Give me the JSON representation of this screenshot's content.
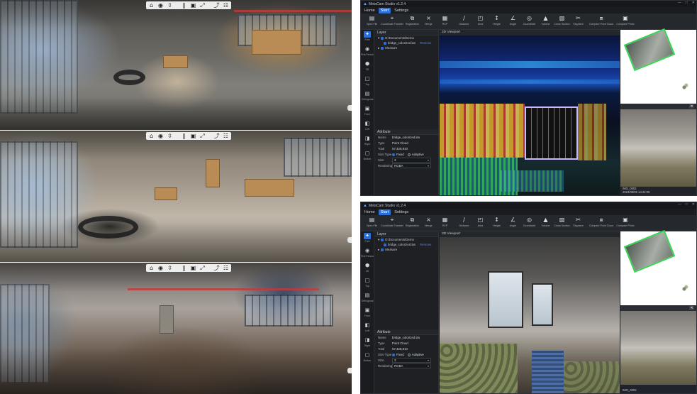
{
  "viewer": {
    "toolbar_icons": [
      "home-icon",
      "pin-icon",
      "arrows-icon",
      "pause-icon",
      "layers-icon",
      "expand-icon",
      "share-icon",
      "gallery-icon"
    ],
    "toolbar_glyphs": [
      "⌂",
      "◉",
      "⇳",
      "‖",
      "▣",
      "⤢",
      "⤴",
      "☷"
    ]
  },
  "app": {
    "title": "MetaCam Studio v1.2.4",
    "menu": [
      "Home",
      "Start",
      "Settings"
    ],
    "active_menu": "Start",
    "ribbon": [
      {
        "icon": "folder-icon",
        "glyph": "▤",
        "label": "Open File"
      },
      {
        "icon": "transform-icon",
        "glyph": "⌖",
        "label": "Coordinate Transfer"
      },
      {
        "icon": "registration-icon",
        "glyph": "⧉",
        "label": "Registration"
      },
      {
        "icon": "merge-icon",
        "glyph": "⨯",
        "label": "Merge"
      },
      {
        "icon": "rcp-icon",
        "glyph": "▦",
        "label": "RCP"
      },
      {
        "icon": "distance-icon",
        "glyph": "∕",
        "label": "Distance"
      },
      {
        "icon": "area-icon",
        "glyph": "◰",
        "label": "Area"
      },
      {
        "icon": "height-icon",
        "glyph": "↕",
        "label": "Height"
      },
      {
        "icon": "angle-icon",
        "glyph": "∠",
        "label": "Angle"
      },
      {
        "icon": "coordinate-icon",
        "glyph": "◎",
        "label": "Coordinate"
      },
      {
        "icon": "volume-icon",
        "glyph": "▲",
        "label": "Volume"
      },
      {
        "icon": "cross-section-icon",
        "glyph": "▧",
        "label": "Cross Section"
      },
      {
        "icon": "segment-icon",
        "glyph": "✂",
        "label": "Segment"
      },
      {
        "icon": "compare-cloud-icon",
        "glyph": "⧈",
        "label": "Compare Point Cloud"
      },
      {
        "icon": "compare-photo-icon",
        "glyph": "▣",
        "label": "Compare Photo"
      }
    ],
    "sidebar": [
      {
        "icon": "free-icon",
        "glyph": "✦",
        "label": "Free"
      },
      {
        "icon": "eye-icon",
        "glyph": "◉",
        "label": "First Person"
      },
      {
        "icon": "3d-icon",
        "glyph": "⬢",
        "label": "3D"
      },
      {
        "icon": "top-icon",
        "glyph": "□",
        "label": "Top"
      },
      {
        "icon": "orthogonal-icon",
        "glyph": "▤",
        "label": "Orthogonal"
      },
      {
        "icon": "front-icon",
        "glyph": "▣",
        "label": "Front"
      },
      {
        "icon": "left-icon",
        "glyph": "◧",
        "label": "Left"
      },
      {
        "icon": "right-icon",
        "glyph": "◨",
        "label": "Right"
      },
      {
        "icon": "bottom-icon",
        "glyph": "▢",
        "label": "Bottom"
      }
    ],
    "layer_panel": {
      "title": "Layer",
      "folder": "D:/Documents/Demo",
      "file": "bridge_colorized.las",
      "remove": "Remove",
      "measure": "Measure"
    },
    "attributes": {
      "title": "Attribute",
      "name_label": "Name",
      "name_value": "bridge_colorized.las",
      "type_label": "Type",
      "type_value": "Point Cloud",
      "total_label": "Total",
      "total_value": "57,428,810",
      "size_type_label": "Size Type",
      "fixed": "Fixed",
      "adaptive": "Adaptive",
      "size_label": "Size",
      "size_value": "3",
      "rendering_label": "Rendering",
      "rendering_value": "RGBA"
    },
    "viewport_title": "3D Viewport",
    "photo_footer_top": "IMG_0002",
    "photo_footer_bottom": "2024/08/06 14:22:05",
    "photo_btn": "✕"
  }
}
